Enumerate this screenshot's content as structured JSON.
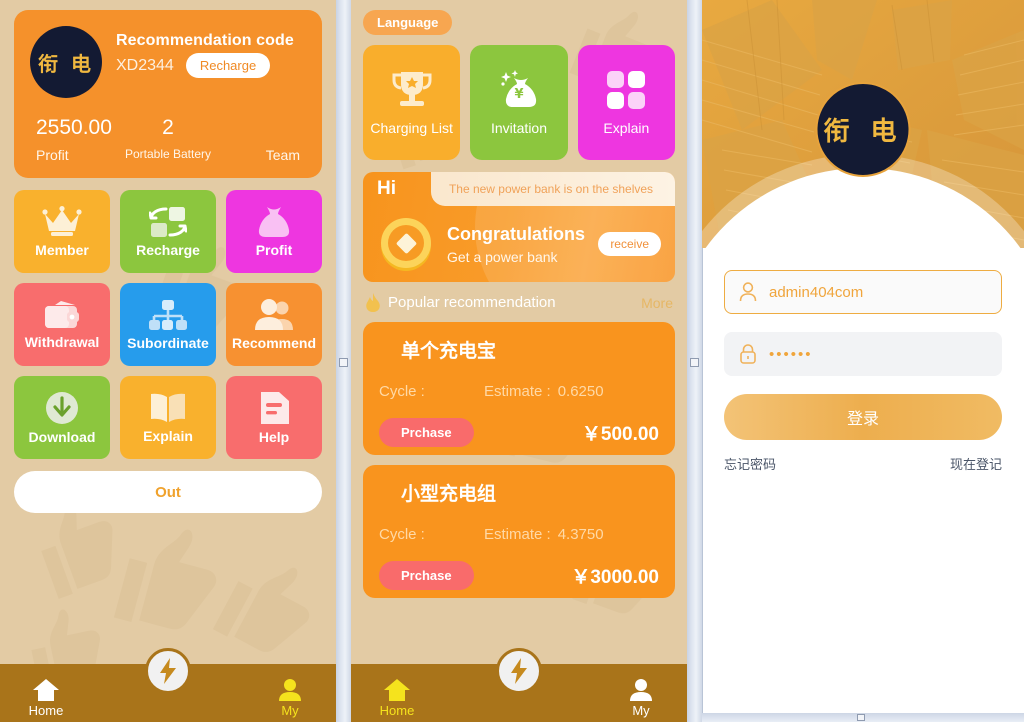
{
  "panel_profile": {
    "logo_text": "衔 电",
    "recommendation_label": "Recommendation code",
    "recommendation_code": "XD2344",
    "recharge_button": "Recharge",
    "stats": [
      {
        "value": "2550.00",
        "label": "Profit"
      },
      {
        "value": "2",
        "label": "Portable Battery"
      },
      {
        "value": "",
        "label": "Team"
      }
    ],
    "tiles": [
      {
        "name": "Member",
        "icon": "crown-icon",
        "color": "#f9b12d"
      },
      {
        "name": "Recharge",
        "icon": "exchange-icon",
        "color": "#8cc63e"
      },
      {
        "name": "Profit",
        "icon": "money-bag-icon",
        "color": "#ee36e0"
      },
      {
        "name": "Withdrawal",
        "icon": "wallet-icon",
        "color": "#f86d6d"
      },
      {
        "name": "Subordinate",
        "icon": "hierarchy-icon",
        "color": "#269cec"
      },
      {
        "name": "Recommend",
        "icon": "users-icon",
        "color": "#f79131"
      },
      {
        "name": "Download",
        "icon": "download-icon",
        "color": "#8cc63e"
      },
      {
        "name": "Explain",
        "icon": "book-icon",
        "color": "#f9b12d"
      },
      {
        "name": "Help",
        "icon": "document-icon",
        "color": "#f86d6d"
      }
    ],
    "out_button": "Out",
    "nav": {
      "home": "Home",
      "my": "My",
      "fab_icon": "lightning-icon",
      "active": "My"
    }
  },
  "panel_home": {
    "language_button": "Language",
    "quick_tiles": [
      {
        "name": "Charging List",
        "icon": "trophy-icon",
        "color": "#f9ae2c"
      },
      {
        "name": "Invitation",
        "icon": "money-bag-yen-icon",
        "color": "#8cc63e"
      },
      {
        "name": "Explain",
        "icon": "four-squares-icon",
        "color": "#ee36e0"
      }
    ],
    "banner": {
      "hi": "Hi",
      "ticker": "The new power bank is on the shelves",
      "title": "Congratulations",
      "subtitle": "Get a power bank",
      "receive_button": "receive",
      "icon": "coin-icon"
    },
    "section": {
      "icon": "flame-icon",
      "title": "Popular recommendation",
      "more": "More"
    },
    "products": [
      {
        "title": "单个充电宝",
        "cycle_label": "Cycle :",
        "estimate_label": "Estimate :",
        "estimate_value": "0.6250",
        "buy_button": "Prchase",
        "price": "￥500.00"
      },
      {
        "title": "小型充电组",
        "cycle_label": "Cycle :",
        "estimate_label": "Estimate :",
        "estimate_value": "4.3750",
        "buy_button": "Prchase",
        "price": "￥3000.00"
      }
    ],
    "nav": {
      "home": "Home",
      "my": "My",
      "fab_icon": "lightning-icon",
      "active": "Home"
    }
  },
  "panel_login": {
    "logo_text": "衔  电",
    "username": {
      "icon": "user-icon",
      "value": "admin404com"
    },
    "password": {
      "icon": "lock-icon",
      "value": "••••••"
    },
    "login_button": "登录",
    "forgot_link": "忘记密码",
    "register_link": "现在登记"
  },
  "colors": {
    "brand_orange": "#f5912b",
    "page_beige": "#e3cba4",
    "navbar_brown": "#a9741a",
    "accent_yellow": "#f5e31d",
    "gold": "#e6a33c"
  }
}
